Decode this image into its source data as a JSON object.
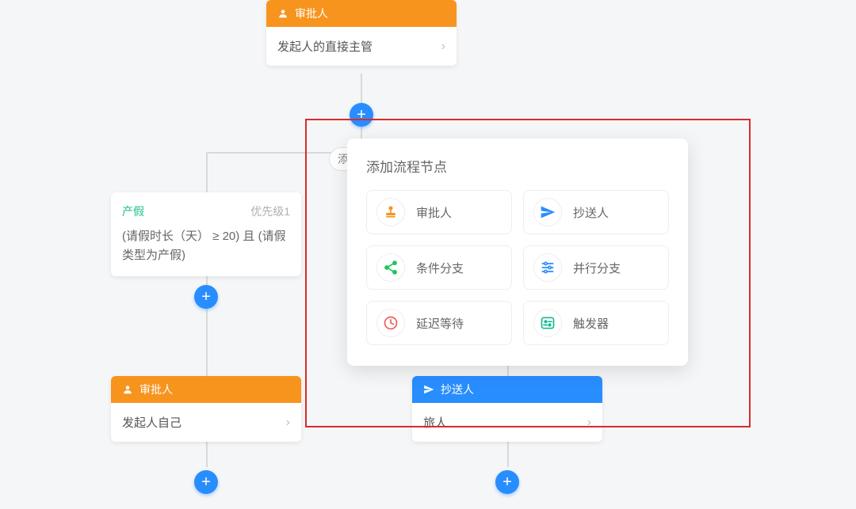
{
  "nodes": {
    "approver1": {
      "type": "审批人",
      "body": "发起人的直接主管"
    },
    "condition1": {
      "title": "产假",
      "priority": "优先级1",
      "expr": "(请假时长（天） ≥ 20) 且 (请假类型为产假)"
    },
    "approver2": {
      "type": "审批人",
      "body": "发起人自己"
    },
    "cc1": {
      "type": "抄送人",
      "body": "旅人"
    }
  },
  "hiddenPill": "添",
  "popover": {
    "title": "添加流程节点",
    "options": {
      "approver": "审批人",
      "cc": "抄送人",
      "conditional": "条件分支",
      "parallel": "并行分支",
      "delay": "延迟等待",
      "trigger": "触发器"
    }
  },
  "colors": {
    "orange": "#f7941e",
    "blue": "#288dff",
    "green": "#1bbf8a",
    "red": "#d82c2c",
    "share": "#22c55e",
    "delay": "#ef5b5b",
    "trigger": "#14b891"
  }
}
